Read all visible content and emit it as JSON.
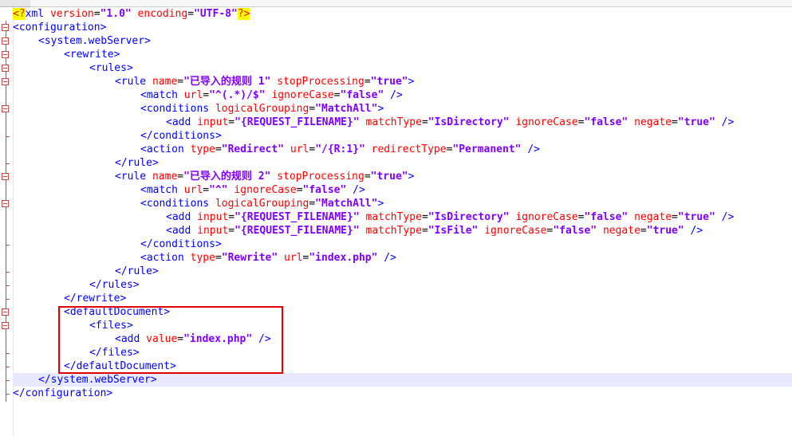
{
  "editor": {
    "language": "XML",
    "lines": [
      {
        "indent": 0,
        "tokens": [
          {
            "k": "pi",
            "v": "<?"
          },
          {
            "k": "tag",
            "v": "xml"
          },
          {
            "k": "text",
            "v": " "
          },
          {
            "k": "attr",
            "v": "version"
          },
          {
            "k": "eq",
            "v": "="
          },
          {
            "k": "val",
            "v": "\"1.0\""
          },
          {
            "k": "text",
            "v": " "
          },
          {
            "k": "attr",
            "v": "encoding"
          },
          {
            "k": "eq",
            "v": "="
          },
          {
            "k": "val",
            "v": "\"UTF-8\""
          },
          {
            "k": "pi",
            "v": "?>"
          }
        ]
      },
      {
        "indent": 0,
        "tokens": [
          {
            "k": "bracket",
            "v": "<"
          },
          {
            "k": "tag",
            "v": "configuration"
          },
          {
            "k": "bracket",
            "v": ">"
          }
        ]
      },
      {
        "indent": 1,
        "tokens": [
          {
            "k": "bracket",
            "v": "<"
          },
          {
            "k": "tag",
            "v": "system.webServer"
          },
          {
            "k": "bracket",
            "v": ">"
          }
        ]
      },
      {
        "indent": 2,
        "tokens": [
          {
            "k": "bracket",
            "v": "<"
          },
          {
            "k": "tag",
            "v": "rewrite"
          },
          {
            "k": "bracket",
            "v": ">"
          }
        ]
      },
      {
        "indent": 3,
        "tokens": [
          {
            "k": "bracket",
            "v": "<"
          },
          {
            "k": "tag",
            "v": "rules"
          },
          {
            "k": "bracket",
            "v": ">"
          }
        ]
      },
      {
        "indent": 4,
        "tokens": [
          {
            "k": "bracket",
            "v": "<"
          },
          {
            "k": "tag",
            "v": "rule"
          },
          {
            "k": "text",
            "v": " "
          },
          {
            "k": "attr",
            "v": "name"
          },
          {
            "k": "eq",
            "v": "="
          },
          {
            "k": "val",
            "v": "\"已导入的规则 1\""
          },
          {
            "k": "text",
            "v": " "
          },
          {
            "k": "attr",
            "v": "stopProcessing"
          },
          {
            "k": "eq",
            "v": "="
          },
          {
            "k": "val",
            "v": "\"true\""
          },
          {
            "k": "bracket",
            "v": ">"
          }
        ]
      },
      {
        "indent": 5,
        "tokens": [
          {
            "k": "bracket",
            "v": "<"
          },
          {
            "k": "tag",
            "v": "match"
          },
          {
            "k": "text",
            "v": " "
          },
          {
            "k": "attr",
            "v": "url"
          },
          {
            "k": "eq",
            "v": "="
          },
          {
            "k": "val",
            "v": "\"^(.*)/$\""
          },
          {
            "k": "text",
            "v": " "
          },
          {
            "k": "attr",
            "v": "ignoreCase"
          },
          {
            "k": "eq",
            "v": "="
          },
          {
            "k": "val",
            "v": "\"false\""
          },
          {
            "k": "text",
            "v": " "
          },
          {
            "k": "bracket",
            "v": "/>"
          }
        ]
      },
      {
        "indent": 5,
        "tokens": [
          {
            "k": "bracket",
            "v": "<"
          },
          {
            "k": "tag",
            "v": "conditions"
          },
          {
            "k": "text",
            "v": " "
          },
          {
            "k": "attr",
            "v": "logicalGrouping"
          },
          {
            "k": "eq",
            "v": "="
          },
          {
            "k": "val",
            "v": "\"MatchAll\""
          },
          {
            "k": "bracket",
            "v": ">"
          }
        ]
      },
      {
        "indent": 6,
        "tokens": [
          {
            "k": "bracket",
            "v": "<"
          },
          {
            "k": "tag",
            "v": "add"
          },
          {
            "k": "text",
            "v": " "
          },
          {
            "k": "attr",
            "v": "input"
          },
          {
            "k": "eq",
            "v": "="
          },
          {
            "k": "val",
            "v": "\"{REQUEST_FILENAME}\""
          },
          {
            "k": "text",
            "v": " "
          },
          {
            "k": "attr",
            "v": "matchType"
          },
          {
            "k": "eq",
            "v": "="
          },
          {
            "k": "val",
            "v": "\"IsDirectory\""
          },
          {
            "k": "text",
            "v": " "
          },
          {
            "k": "attr",
            "v": "ignoreCase"
          },
          {
            "k": "eq",
            "v": "="
          },
          {
            "k": "val",
            "v": "\"false\""
          },
          {
            "k": "text",
            "v": " "
          },
          {
            "k": "attr",
            "v": "negate"
          },
          {
            "k": "eq",
            "v": "="
          },
          {
            "k": "val",
            "v": "\"true\""
          },
          {
            "k": "text",
            "v": " "
          },
          {
            "k": "bracket",
            "v": "/>"
          }
        ]
      },
      {
        "indent": 5,
        "tokens": [
          {
            "k": "bracket",
            "v": "</"
          },
          {
            "k": "tag",
            "v": "conditions"
          },
          {
            "k": "bracket",
            "v": ">"
          }
        ]
      },
      {
        "indent": 5,
        "tokens": [
          {
            "k": "bracket",
            "v": "<"
          },
          {
            "k": "tag",
            "v": "action"
          },
          {
            "k": "text",
            "v": " "
          },
          {
            "k": "attr",
            "v": "type"
          },
          {
            "k": "eq",
            "v": "="
          },
          {
            "k": "val",
            "v": "\"Redirect\""
          },
          {
            "k": "text",
            "v": " "
          },
          {
            "k": "attr",
            "v": "url"
          },
          {
            "k": "eq",
            "v": "="
          },
          {
            "k": "val",
            "v": "\"/{R:1}\""
          },
          {
            "k": "text",
            "v": " "
          },
          {
            "k": "attr",
            "v": "redirectType"
          },
          {
            "k": "eq",
            "v": "="
          },
          {
            "k": "val",
            "v": "\"Permanent\""
          },
          {
            "k": "text",
            "v": " "
          },
          {
            "k": "bracket",
            "v": "/>"
          }
        ]
      },
      {
        "indent": 4,
        "tokens": [
          {
            "k": "bracket",
            "v": "</"
          },
          {
            "k": "tag",
            "v": "rule"
          },
          {
            "k": "bracket",
            "v": ">"
          }
        ]
      },
      {
        "indent": 4,
        "tokens": [
          {
            "k": "bracket",
            "v": "<"
          },
          {
            "k": "tag",
            "v": "rule"
          },
          {
            "k": "text",
            "v": " "
          },
          {
            "k": "attr",
            "v": "name"
          },
          {
            "k": "eq",
            "v": "="
          },
          {
            "k": "val",
            "v": "\"已导入的规则 2\""
          },
          {
            "k": "text",
            "v": " "
          },
          {
            "k": "attr",
            "v": "stopProcessing"
          },
          {
            "k": "eq",
            "v": "="
          },
          {
            "k": "val",
            "v": "\"true\""
          },
          {
            "k": "bracket",
            "v": ">"
          }
        ]
      },
      {
        "indent": 5,
        "tokens": [
          {
            "k": "bracket",
            "v": "<"
          },
          {
            "k": "tag",
            "v": "match"
          },
          {
            "k": "text",
            "v": " "
          },
          {
            "k": "attr",
            "v": "url"
          },
          {
            "k": "eq",
            "v": "="
          },
          {
            "k": "val",
            "v": "\"^\""
          },
          {
            "k": "text",
            "v": " "
          },
          {
            "k": "attr",
            "v": "ignoreCase"
          },
          {
            "k": "eq",
            "v": "="
          },
          {
            "k": "val",
            "v": "\"false\""
          },
          {
            "k": "text",
            "v": " "
          },
          {
            "k": "bracket",
            "v": "/>"
          }
        ]
      },
      {
        "indent": 5,
        "tokens": [
          {
            "k": "bracket",
            "v": "<"
          },
          {
            "k": "tag",
            "v": "conditions"
          },
          {
            "k": "text",
            "v": " "
          },
          {
            "k": "attr",
            "v": "logicalGrouping"
          },
          {
            "k": "eq",
            "v": "="
          },
          {
            "k": "val",
            "v": "\"MatchAll\""
          },
          {
            "k": "bracket",
            "v": ">"
          }
        ]
      },
      {
        "indent": 6,
        "tokens": [
          {
            "k": "bracket",
            "v": "<"
          },
          {
            "k": "tag",
            "v": "add"
          },
          {
            "k": "text",
            "v": " "
          },
          {
            "k": "attr",
            "v": "input"
          },
          {
            "k": "eq",
            "v": "="
          },
          {
            "k": "val",
            "v": "\"{REQUEST_FILENAME}\""
          },
          {
            "k": "text",
            "v": " "
          },
          {
            "k": "attr",
            "v": "matchType"
          },
          {
            "k": "eq",
            "v": "="
          },
          {
            "k": "val",
            "v": "\"IsDirectory\""
          },
          {
            "k": "text",
            "v": " "
          },
          {
            "k": "attr",
            "v": "ignoreCase"
          },
          {
            "k": "eq",
            "v": "="
          },
          {
            "k": "val",
            "v": "\"false\""
          },
          {
            "k": "text",
            "v": " "
          },
          {
            "k": "attr",
            "v": "negate"
          },
          {
            "k": "eq",
            "v": "="
          },
          {
            "k": "val",
            "v": "\"true\""
          },
          {
            "k": "text",
            "v": " "
          },
          {
            "k": "bracket",
            "v": "/>"
          }
        ]
      },
      {
        "indent": 6,
        "tokens": [
          {
            "k": "bracket",
            "v": "<"
          },
          {
            "k": "tag",
            "v": "add"
          },
          {
            "k": "text",
            "v": " "
          },
          {
            "k": "attr",
            "v": "input"
          },
          {
            "k": "eq",
            "v": "="
          },
          {
            "k": "val",
            "v": "\"{REQUEST_FILENAME}\""
          },
          {
            "k": "text",
            "v": " "
          },
          {
            "k": "attr",
            "v": "matchType"
          },
          {
            "k": "eq",
            "v": "="
          },
          {
            "k": "val",
            "v": "\"IsFile\""
          },
          {
            "k": "text",
            "v": " "
          },
          {
            "k": "attr",
            "v": "ignoreCase"
          },
          {
            "k": "eq",
            "v": "="
          },
          {
            "k": "val",
            "v": "\"false\""
          },
          {
            "k": "text",
            "v": " "
          },
          {
            "k": "attr",
            "v": "negate"
          },
          {
            "k": "eq",
            "v": "="
          },
          {
            "k": "val",
            "v": "\"true\""
          },
          {
            "k": "text",
            "v": " "
          },
          {
            "k": "bracket",
            "v": "/>"
          }
        ]
      },
      {
        "indent": 5,
        "tokens": [
          {
            "k": "bracket",
            "v": "</"
          },
          {
            "k": "tag",
            "v": "conditions"
          },
          {
            "k": "bracket",
            "v": ">"
          }
        ]
      },
      {
        "indent": 5,
        "tokens": [
          {
            "k": "bracket",
            "v": "<"
          },
          {
            "k": "tag",
            "v": "action"
          },
          {
            "k": "text",
            "v": " "
          },
          {
            "k": "attr",
            "v": "type"
          },
          {
            "k": "eq",
            "v": "="
          },
          {
            "k": "val",
            "v": "\"Rewrite\""
          },
          {
            "k": "text",
            "v": " "
          },
          {
            "k": "attr",
            "v": "url"
          },
          {
            "k": "eq",
            "v": "="
          },
          {
            "k": "val",
            "v": "\"index.php\""
          },
          {
            "k": "text",
            "v": " "
          },
          {
            "k": "bracket",
            "v": "/>"
          }
        ]
      },
      {
        "indent": 4,
        "tokens": [
          {
            "k": "bracket",
            "v": "</"
          },
          {
            "k": "tag",
            "v": "rule"
          },
          {
            "k": "bracket",
            "v": ">"
          }
        ]
      },
      {
        "indent": 3,
        "tokens": [
          {
            "k": "bracket",
            "v": "</"
          },
          {
            "k": "tag",
            "v": "rules"
          },
          {
            "k": "bracket",
            "v": ">"
          }
        ]
      },
      {
        "indent": 2,
        "tokens": [
          {
            "k": "bracket",
            "v": "</"
          },
          {
            "k": "tag",
            "v": "rewrite"
          },
          {
            "k": "bracket",
            "v": ">"
          }
        ]
      },
      {
        "indent": 2,
        "tokens": [
          {
            "k": "bracket",
            "v": "<"
          },
          {
            "k": "tag",
            "v": "defaultDocument"
          },
          {
            "k": "bracket",
            "v": ">"
          }
        ]
      },
      {
        "indent": 3,
        "tokens": [
          {
            "k": "bracket",
            "v": "<"
          },
          {
            "k": "tag",
            "v": "files"
          },
          {
            "k": "bracket",
            "v": ">"
          }
        ]
      },
      {
        "indent": 4,
        "tokens": [
          {
            "k": "bracket",
            "v": "<"
          },
          {
            "k": "tag",
            "v": "add"
          },
          {
            "k": "text",
            "v": " "
          },
          {
            "k": "attr",
            "v": "value"
          },
          {
            "k": "eq",
            "v": "="
          },
          {
            "k": "val",
            "v": "\"index.php\""
          },
          {
            "k": "text",
            "v": " "
          },
          {
            "k": "bracket",
            "v": "/>"
          }
        ]
      },
      {
        "indent": 3,
        "tokens": [
          {
            "k": "bracket",
            "v": "</"
          },
          {
            "k": "tag",
            "v": "files"
          },
          {
            "k": "bracket",
            "v": ">"
          }
        ]
      },
      {
        "indent": 2,
        "tokens": [
          {
            "k": "bracket",
            "v": "</"
          },
          {
            "k": "tag",
            "v": "defaultDocument"
          },
          {
            "k": "bracket",
            "v": ">"
          }
        ]
      },
      {
        "indent": 1,
        "current": true,
        "tokens": [
          {
            "k": "bracket",
            "v": "</"
          },
          {
            "k": "tag",
            "v": "system.webServer"
          },
          {
            "k": "bracket",
            "v": ">"
          }
        ]
      },
      {
        "indent": 0,
        "tokens": [
          {
            "k": "bracket",
            "v": "</"
          },
          {
            "k": "tag",
            "v": "configuration"
          },
          {
            "k": "bracket",
            "v": ">"
          }
        ]
      }
    ]
  },
  "colors": {
    "tag": "#0000ff",
    "attribute": "#ff0000",
    "value": "#8000ff",
    "pi_background": "#ffff00",
    "highlight_box": "#e00000",
    "current_line": "#e8e8ff",
    "fold_marker": "#c84a4a"
  }
}
